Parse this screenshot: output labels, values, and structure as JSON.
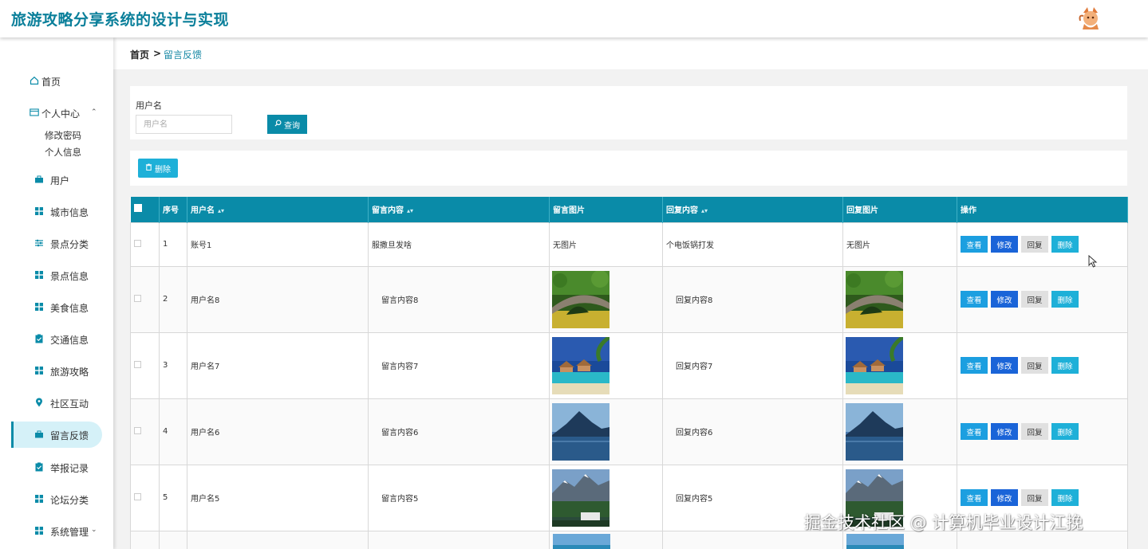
{
  "app": {
    "title": "旅游攻略分享系统的设计与实现"
  },
  "breadcrumb": {
    "home": "首页",
    "separator": ">",
    "current": "留言反馈"
  },
  "sidebar": {
    "home": "首页",
    "personal": {
      "label": "个人中心",
      "children": [
        "修改密码",
        "个人信息"
      ]
    },
    "items": [
      {
        "label": "用户",
        "icon": "briefcase-icon"
      },
      {
        "label": "城市信息",
        "icon": "grid-icon"
      },
      {
        "label": "景点分类",
        "icon": "sliders-icon"
      },
      {
        "label": "景点信息",
        "icon": "grid-icon"
      },
      {
        "label": "美食信息",
        "icon": "grid-icon"
      },
      {
        "label": "交通信息",
        "icon": "clipboard-icon"
      },
      {
        "label": "旅游攻略",
        "icon": "grid-icon"
      },
      {
        "label": "社区互动",
        "icon": "pin-icon"
      },
      {
        "label": "留言反馈",
        "icon": "briefcase-icon",
        "active": true
      },
      {
        "label": "举报记录",
        "icon": "clipboard-icon"
      },
      {
        "label": "论坛分类",
        "icon": "grid-icon"
      },
      {
        "label": "系统管理",
        "icon": "grid-icon"
      }
    ]
  },
  "search": {
    "label": "用户名",
    "placeholder": "用户名",
    "button": "查询"
  },
  "actions": {
    "delete": "删除"
  },
  "table": {
    "headers": [
      "序号",
      "用户名",
      "留言内容",
      "留言图片",
      "回复内容",
      "回复图片",
      "操作"
    ],
    "op_labels": {
      "view": "查看",
      "edit": "修改",
      "reply": "回复",
      "delete": "删除"
    },
    "rows": [
      {
        "no": "1",
        "user": "账号1",
        "msg": "服撒旦发啥",
        "msg_img": "无图片",
        "reply": "个电饭锅打发",
        "reply_img": "无图片"
      },
      {
        "no": "2",
        "user": "用户名8",
        "msg": "留言内容8",
        "msg_img": "bridge",
        "reply": "回复内容8",
        "reply_img": "bridge"
      },
      {
        "no": "3",
        "user": "用户名7",
        "msg": "留言内容7",
        "msg_img": "bungalow",
        "reply": "回复内容7",
        "reply_img": "bungalow"
      },
      {
        "no": "4",
        "user": "用户名6",
        "msg": "留言内容6",
        "msg_img": "lake",
        "reply": "回复内容6",
        "reply_img": "lake"
      },
      {
        "no": "5",
        "user": "用户名5",
        "msg": "留言内容5",
        "msg_img": "mountain",
        "reply": "回复内容5",
        "reply_img": "mountain"
      }
    ]
  },
  "watermark": "掘金技术社区 @ 计算机毕业设计江挽"
}
